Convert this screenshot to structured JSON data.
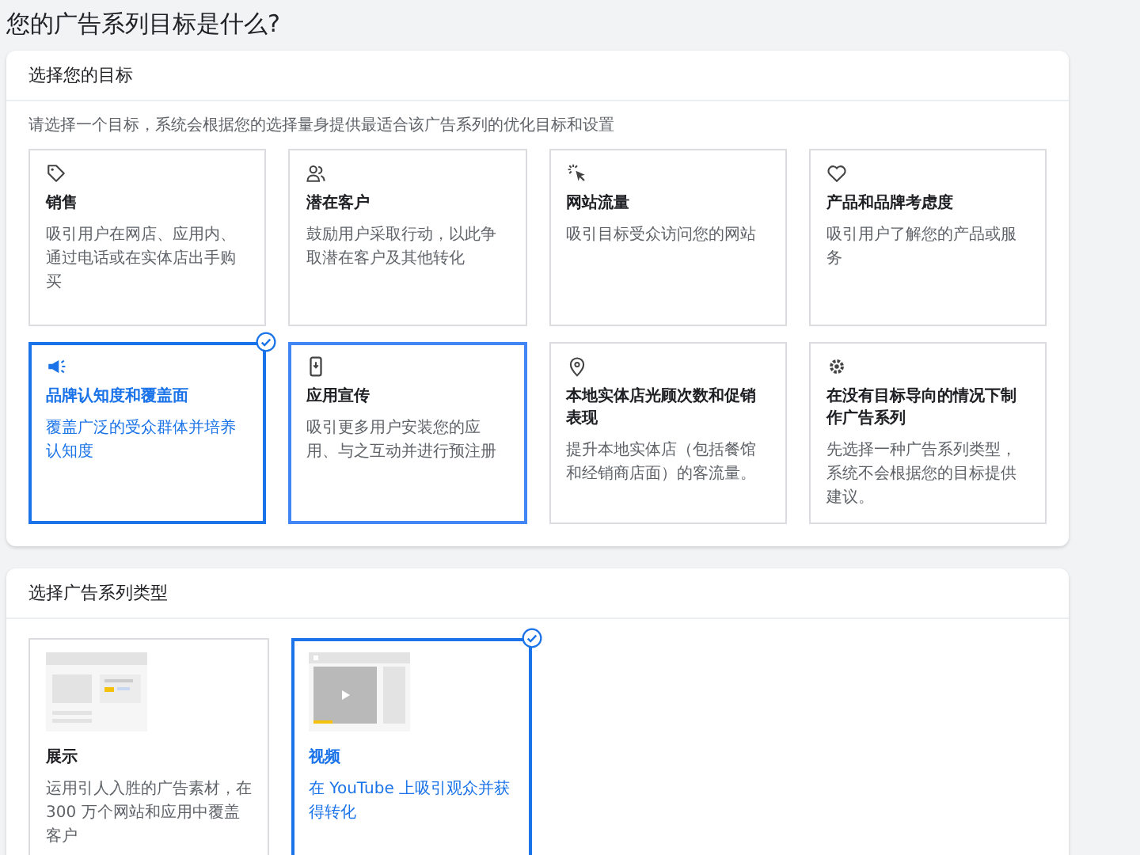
{
  "page_title": "您的广告系列目标是什么?",
  "goals_section": {
    "title": "选择您的目标",
    "hint": "请选择一个目标，系统会根据您的选择量身提供最适合该广告系列的优化目标和设置",
    "goals": [
      {
        "kind": "tag",
        "title": "销售",
        "description": "吸引用户在网店、应用内、通过电话或在实体店出手购买",
        "selected": false,
        "highlighted": false
      },
      {
        "kind": "people",
        "title": "潜在客户",
        "description": "鼓励用户采取行动，以此争取潜在客户及其他转化",
        "selected": false,
        "highlighted": false
      },
      {
        "kind": "cursor",
        "title": "网站流量",
        "description": "吸引目标受众访问您的网站",
        "selected": false,
        "highlighted": false
      },
      {
        "kind": "heart",
        "title": "产品和品牌考虑度",
        "description": "吸引用户了解您的产品或服务",
        "selected": false,
        "highlighted": false
      },
      {
        "kind": "megaphone",
        "title": "品牌认知度和覆盖面",
        "description": "覆盖广泛的受众群体并培养认知度",
        "selected": true,
        "highlighted": false
      },
      {
        "kind": "phone",
        "title": "应用宣传",
        "description": "吸引更多用户安装您的应用、与之互动并进行预注册",
        "selected": false,
        "highlighted": true
      },
      {
        "kind": "pin",
        "title": "本地实体店光顾次数和促销表现",
        "description": "提升本地实体店（包括餐馆和经销商店面）的客流量。",
        "selected": false,
        "highlighted": false
      },
      {
        "kind": "gear",
        "title": "在没有目标导向的情况下制作广告系列",
        "description": "先选择一种广告系列类型，系统不会根据您的目标提供建议。",
        "selected": false,
        "highlighted": false
      }
    ]
  },
  "type_section": {
    "title": "选择广告系列类型",
    "types": [
      {
        "kind": "display",
        "title": "展示",
        "description": "运用引人入胜的广告素材，在 300 万个网站和应用中覆盖客户",
        "selected": false
      },
      {
        "kind": "video",
        "title": "视频",
        "description": "在 YouTube 上吸引观众并获得转化",
        "selected": true
      }
    ]
  }
}
